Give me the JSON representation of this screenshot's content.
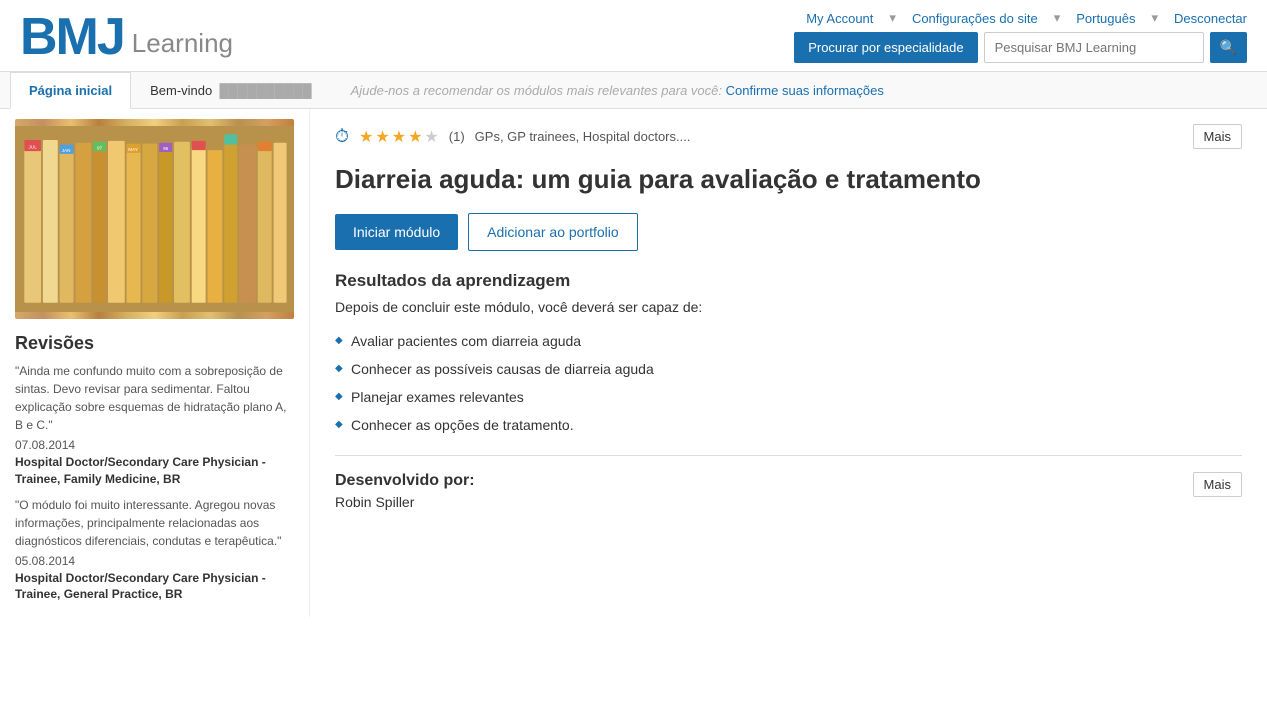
{
  "header": {
    "logo_bmj": "BMJ",
    "logo_learning": "Learning",
    "nav": {
      "my_account": "My Account",
      "configuracoes": "Configurações do site",
      "language": "Português",
      "desconectar": "Desconectar"
    },
    "search": {
      "specialty_btn": "Procurar por especialidade",
      "placeholder": "Pesquisar BMJ Learning",
      "search_icon": "🔍"
    }
  },
  "tabs": {
    "pagina_inicial": "Página inicial",
    "bem_vindo": "Bem-vindo"
  },
  "welcome_bar": {
    "prefix": "Bem-vindo",
    "username": "██████████",
    "message": "Ajude-nos a recomendar os módulos mais relevantes para você:",
    "confirm_link": "Confirme suas informações"
  },
  "module": {
    "clock_label": "⏱",
    "stars_filled": 4,
    "stars_empty": 1,
    "rating_count": "(1)",
    "audience": "GPs, GP trainees, Hospital doctors....",
    "mais_label": "Mais",
    "title": "Diarreia aguda: um guia para avaliação e tratamento",
    "btn_start": "Iniciar módulo",
    "btn_portfolio": "Adicionar ao portfolio",
    "outcomes_section_title": "Resultados da aprendizagem",
    "outcomes_intro": "Depois de concluir este módulo, você deverá ser capaz de:",
    "outcomes": [
      "Avaliar pacientes com diarreia aguda",
      "Conhecer as possíveis causas de diarreia aguda",
      "Planejar exames relevantes",
      "Conhecer as opções de tratamento."
    ],
    "developed_by_label": "Desenvolvido por:",
    "developed_by_mais": "Mais",
    "author": "Robin Spiller"
  },
  "reviews": {
    "title": "Revisões",
    "items": [
      {
        "text": "\"Ainda me confundo muito com a sobreposição de sintas. Devo revisar para sedimentar. Faltou explicação sobre esquemas de hidratação plano A, B e C.\"",
        "date": "07.08.2014",
        "author": "Hospital Doctor/Secondary Care Physician - Trainee, Family Medicine, BR"
      },
      {
        "text": "\"O módulo foi muito interessante. Agregou novas informações, principalmente relacionadas aos diagnósticos diferenciais, condutas e terapêutica.\"",
        "date": "05.08.2014",
        "author": "Hospital Doctor/Secondary Care Physician - Trainee, General Practice, BR"
      }
    ]
  },
  "colors": {
    "accent": "#1a6faf",
    "star_fill": "#f5a623",
    "text_dark": "#333333",
    "text_gray": "#555555"
  }
}
